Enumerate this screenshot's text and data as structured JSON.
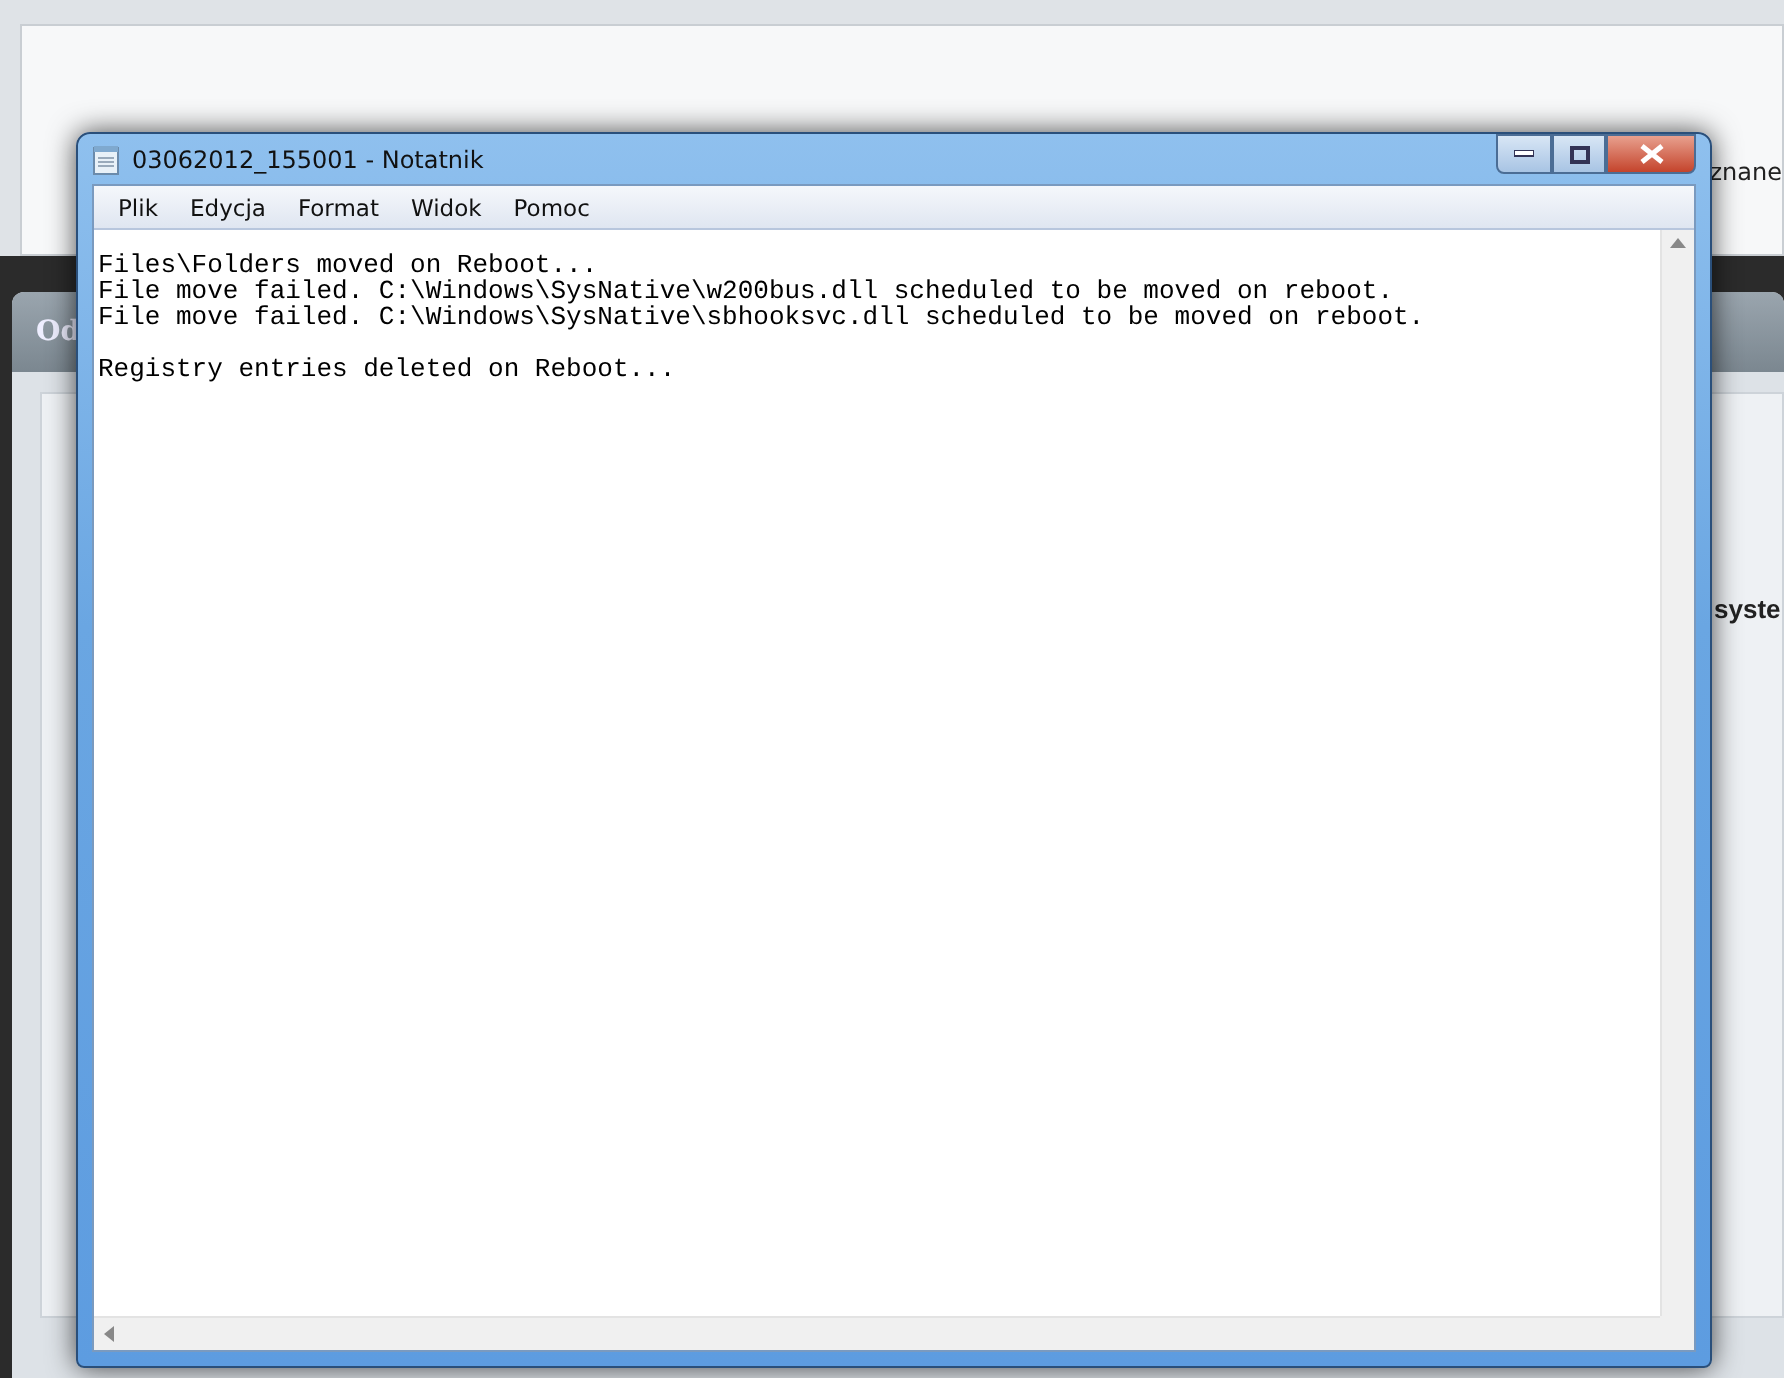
{
  "background": {
    "panel_header": "Od",
    "right_text_top": "znane",
    "right_text_bold": "syste"
  },
  "window": {
    "title": "03062012_155001 - Notatnik"
  },
  "menu": [
    "Plik",
    "Edycja",
    "Format",
    "Widok",
    "Pomoc"
  ],
  "blocks": [
    [
      "Files\\Folders moved on Reboot...",
      "File move failed. C:\\Windows\\SysNative\\w200bus.dll scheduled to be moved on reboot.",
      "File move failed. C:\\Windows\\SysNative\\sbhooksvc.dll scheduled to be moved on reboot."
    ],
    [
      "Registry entries deleted on Reboot..."
    ]
  ]
}
